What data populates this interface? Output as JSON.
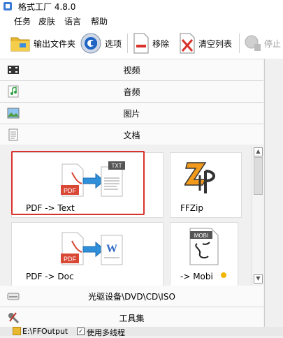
{
  "window": {
    "title": "格式工厂 4.8.0"
  },
  "menu": [
    {
      "label": "任务"
    },
    {
      "label": "皮肤"
    },
    {
      "label": "语言"
    },
    {
      "label": "帮助"
    }
  ],
  "toolbar": {
    "output_folder": "输出文件夹",
    "options": "选项",
    "remove": "移除",
    "clear_list": "清空列表",
    "stop": "停止"
  },
  "categories": {
    "video": "视频",
    "audio": "音频",
    "image": "图片",
    "document": "文档",
    "optical": "光驱设备\\DVD\\CD\\ISO",
    "toolbox": "工具集"
  },
  "document_tools": [
    {
      "label": "PDF -> Text",
      "badge": "TXT"
    },
    {
      "label": "FFZip"
    },
    {
      "label": "PDF -> Doc",
      "badge": "W"
    },
    {
      "label": "-> Mobi",
      "badge": "MOBI"
    }
  ],
  "pdf_badge": "PDF",
  "status": {
    "output_path": "E:\\FFOutput",
    "multithread_label": "使用多线程"
  },
  "colors": {
    "highlight": "#d9322b",
    "pdf_red": "#d94735",
    "arrow_blue": "#2f8fd8",
    "mobi_dot": "#f4b400"
  }
}
